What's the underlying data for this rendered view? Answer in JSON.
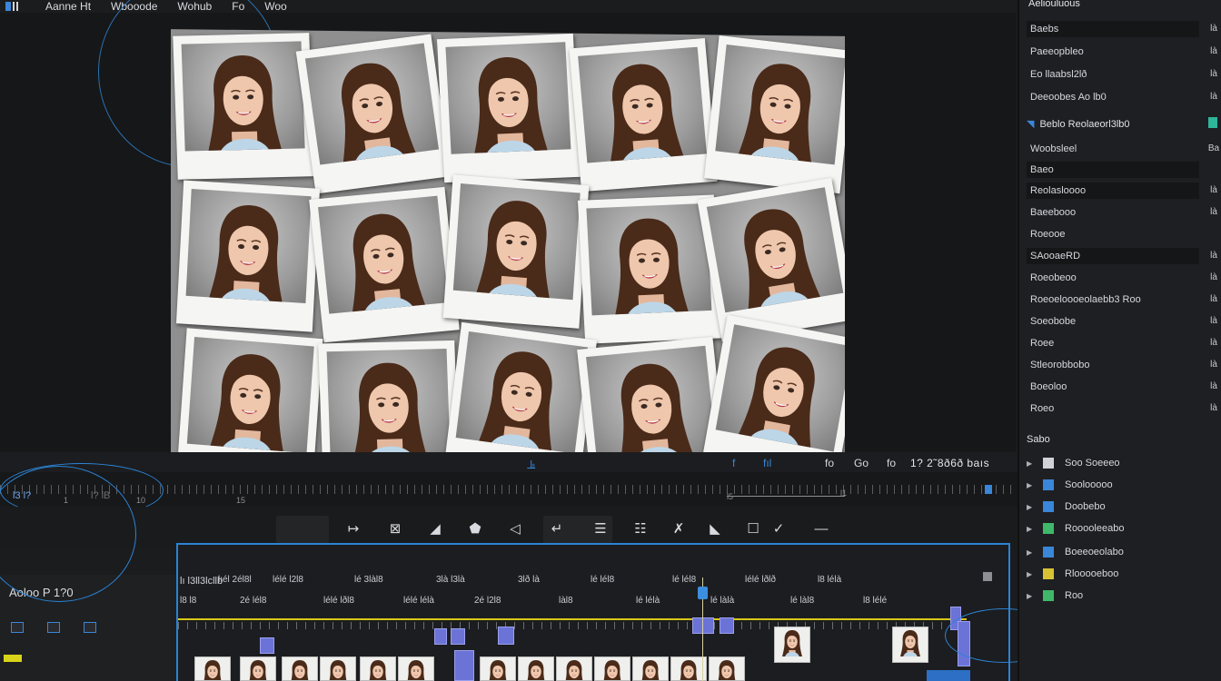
{
  "menubar": {
    "items": [
      "Aanne Ht",
      "Wbooode",
      "Wohub",
      "Fo",
      "Woo"
    ]
  },
  "viewer": {
    "photo_count": 15,
    "photo_caption": "portrait of smiling woman"
  },
  "transport": {
    "labels": [
      "f",
      "fıl",
      "fo",
      "Go",
      "fo",
      "fo"
    ],
    "timecode": "1? 2˜8ð6ð baıs"
  },
  "ruler": {
    "in_label": "l3 l?",
    "in_label2": "l? lB",
    "marks": [
      "1",
      "10",
      "15",
      "18",
      "l5",
      "l1"
    ]
  },
  "tools": {
    "icons": [
      "forward-arrow-icon",
      "trim-box-icon",
      "ripple-icon",
      "slip-icon",
      "blade-icon",
      "track-select-icon",
      "list-icon",
      "hand-icon",
      "zoom-icon",
      "text-tool-icon",
      "pen-icon",
      "line-icon"
    ]
  },
  "timeline": {
    "sequence_title": "Aoloo P 1?0",
    "header_left": "lı l3ll3lcllb",
    "ruler_labels": [
      "lıél 2él8l",
      "lélé l2l8",
      "lé 3làl8",
      "3là l3là",
      "3lð là",
      "lé lél8",
      "lé lél8",
      "lélé lðlð",
      "l8 lélà"
    ],
    "row2_labels": [
      "l8 l8",
      "2é lél8",
      "lélé lðl8",
      "lélé lélà",
      "2é l2l8",
      "làl8",
      "lé lélà",
      "lé làlà",
      "lé làl8",
      "l8 lélé"
    ],
    "clip_count": 17
  },
  "panel": {
    "title": "Aeliouluous",
    "properties": [
      {
        "label": "Baebs",
        "value": "là"
      },
      {
        "label": "Paeeopbleo",
        "value": "là"
      },
      {
        "label": "Eo llaabsl2lð",
        "value": "là"
      },
      {
        "label": "Deeoobes Ao lb0",
        "value": "là"
      }
    ],
    "section1": "Beblo Reolaeorl3lb0",
    "properties2": [
      {
        "label": "Woobsleel",
        "value": "Ba"
      },
      {
        "label": "Baeo",
        "value": ""
      },
      {
        "label": "Reolasloooo",
        "value": "là"
      },
      {
        "label": "Baeebooo",
        "value": "là"
      },
      {
        "label": "Roeooe",
        "value": ""
      },
      {
        "label": "SAooaeRD",
        "value": "là"
      },
      {
        "label": "Roeobeoo",
        "value": "là"
      },
      {
        "label": "Roeoeloooeolaebb3 Roo",
        "value": "là"
      },
      {
        "label": "Soeobobe",
        "value": "là"
      },
      {
        "label": "Roee",
        "value": "là"
      },
      {
        "label": "Stleorobbobo",
        "value": "là"
      },
      {
        "label": "Boeoloo",
        "value": "là"
      },
      {
        "label": "Roeo",
        "value": "là"
      }
    ],
    "section2": "Sabo",
    "tree": [
      {
        "label": "Soo Soeeeo",
        "color": "#cfd3d8"
      },
      {
        "label": "Soolooooo",
        "color": "#3a86d8"
      },
      {
        "label": "Doobebo",
        "color": "#3a86d8"
      },
      {
        "label": "Rooooleeabo",
        "color": "#3fb86a"
      },
      {
        "label": "Boeeoeolabo",
        "color": "#3a86d8"
      },
      {
        "label": "Rlooooeboo",
        "color": "#d8c234"
      },
      {
        "label": "Roo",
        "color": "#3fb86a"
      }
    ]
  }
}
